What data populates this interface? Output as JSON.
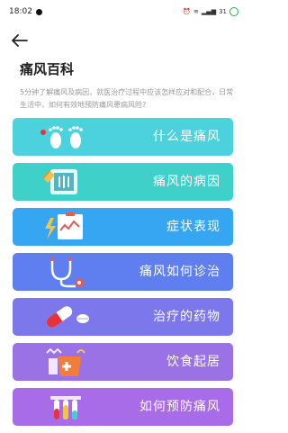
{
  "status": {
    "time": "18:02",
    "battery": "31"
  },
  "header": {
    "title": "痛风百科",
    "intro": "5分钟了解痛风及病因，就医治疗过程中应该怎样应对和配合，日常生活中，如何有效地预防痛风患病风险?"
  },
  "menu": {
    "items": [
      {
        "label": "什么是痛风",
        "color": "#4cd2dc",
        "icon": "footprints-icon"
      },
      {
        "label": "痛风的病因",
        "color": "#3fd0c9",
        "icon": "x-ray-icon"
      },
      {
        "label": "症状表现",
        "color": "#37a6f2",
        "icon": "chart-clipboard-icon"
      },
      {
        "label": "痛风如何诊治",
        "color": "#5f7ff0",
        "icon": "stethoscope-icon"
      },
      {
        "label": "治疗的药物",
        "color": "#7c78ec",
        "icon": "pill-icon"
      },
      {
        "label": "饮食起居",
        "color": "#9a72e6",
        "icon": "food-icon"
      },
      {
        "label": "如何预防痛风",
        "color": "#a96ce8",
        "icon": "test-tubes-icon"
      }
    ]
  }
}
